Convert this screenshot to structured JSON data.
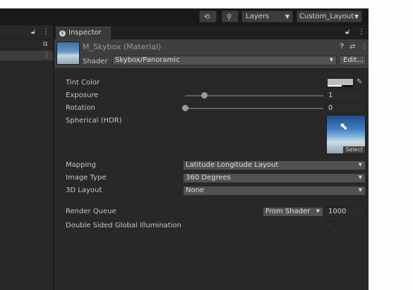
{
  "toolbar": {
    "history_icon": "history-icon",
    "search_icon": "search-icon",
    "layers_label": "Layers",
    "layout_label": "Custom_Layout"
  },
  "left_panel": {
    "lock_icon": "lock-icon",
    "menu_icon": "kebab-menu-icon"
  },
  "inspector": {
    "tab_label": "Inspector",
    "material_name": "M_Skybox (Material)",
    "shader_label": "Shader",
    "shader_value": "Skybox/Panoramic",
    "edit_button": "Edit...",
    "properties": {
      "tint_color_label": "Tint Color",
      "exposure_label": "Exposure",
      "exposure_value": "1",
      "exposure_slider_fraction": 0.14,
      "rotation_label": "Rotation",
      "rotation_value": "0",
      "rotation_slider_fraction": 0.0,
      "spherical_label": "Spherical  (HDR)",
      "select_label": "Select",
      "mapping_label": "Mapping",
      "mapping_value": "Latitude Longitude Layout",
      "image_type_label": "Image Type",
      "image_type_value": "360 Degrees",
      "layout_3d_label": "3D Layout",
      "layout_3d_value": "None",
      "render_queue_label": "Render Queue",
      "render_queue_mode": "From Shader",
      "render_queue_value": "1000",
      "double_sided_label": "Double Sided Global Illumination",
      "double_sided_checked": false
    }
  },
  "colors": {
    "panel_bg": "#282828",
    "header_bg": "#3e3e3e",
    "field_bg": "#2a2a2a",
    "dropdown_bg": "#515151"
  }
}
